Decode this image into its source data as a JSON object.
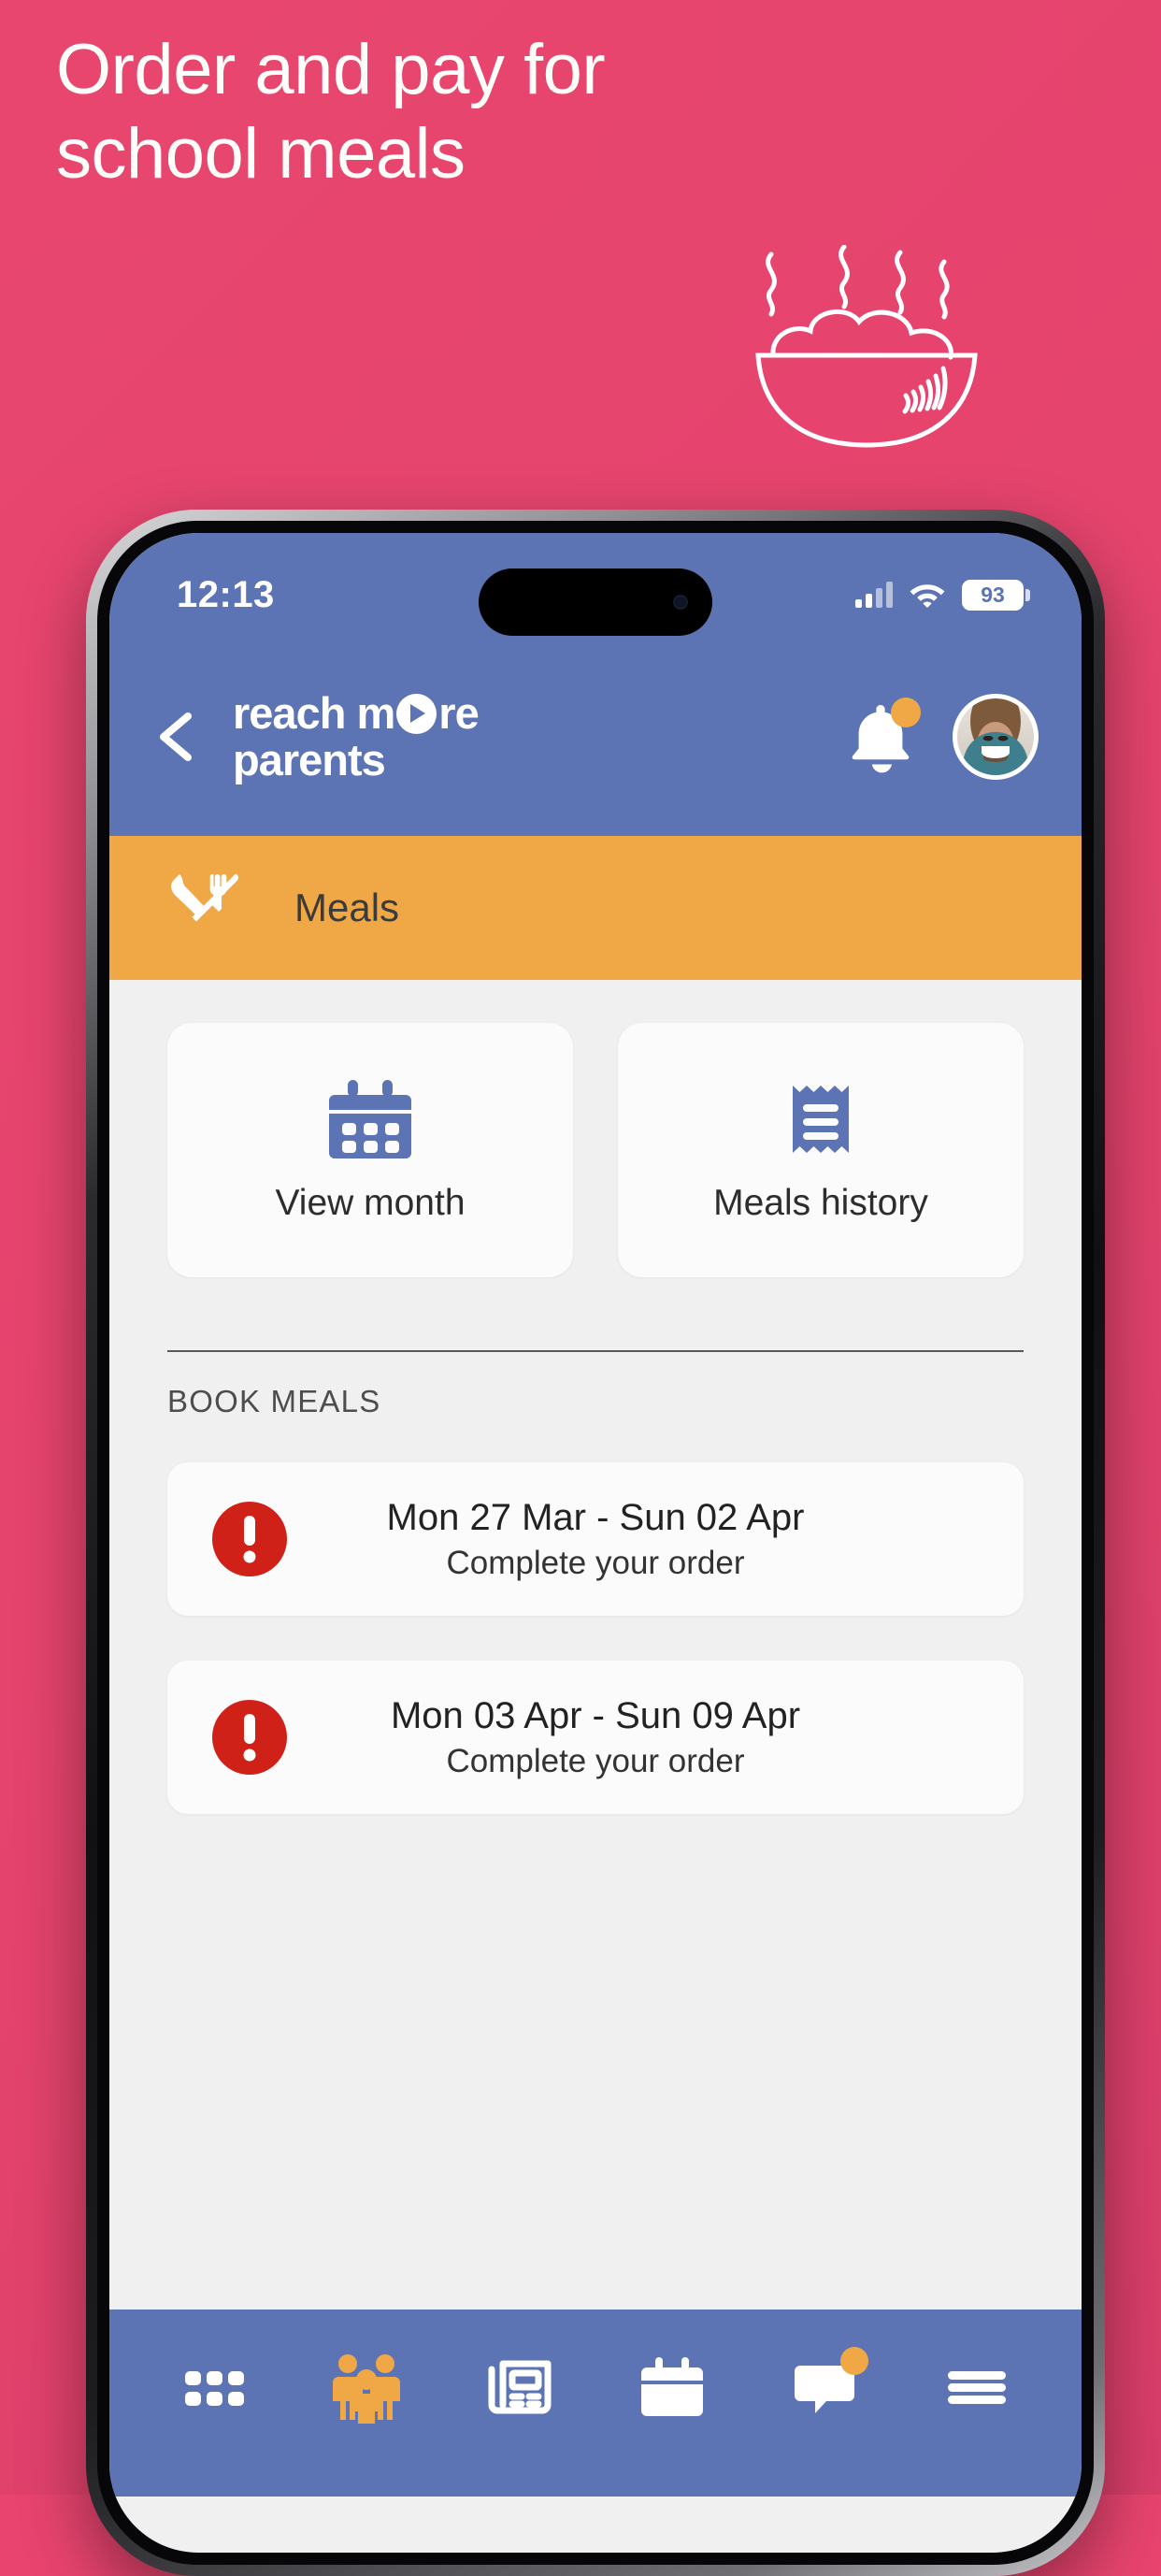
{
  "promo": {
    "headline": "Order and pay for\nschool meals",
    "background_color": "#e8446f",
    "text_color": "#fdfdfa",
    "doodle": "steaming-food-bowl-doodle"
  },
  "phone": {
    "status_bar": {
      "time": "12:13",
      "signal_icon": "cellular-signal-icon",
      "signal_bars_filled": 2,
      "signal_bars_total": 4,
      "wifi_icon": "wifi-icon",
      "battery_level": "93",
      "battery_icon": "battery-icon"
    },
    "colors": {
      "brand_blue": "#5c74b4",
      "brand_orange": "#f0a847",
      "alert_red": "#cf2118",
      "screen_background": "#f0f0f0",
      "card_background": "#fbfbfb"
    }
  },
  "header": {
    "back_icon": "chevron-left-icon",
    "logo_line1_a": "reach m",
    "logo_line1_b": "re",
    "logo_line2": "parents",
    "bell_icon": "bell-icon",
    "bell_has_badge": true,
    "avatar_icon": "user-avatar-photo"
  },
  "page_banner": {
    "icon": "fork-knife-icon",
    "title": "Meals"
  },
  "tiles": [
    {
      "icon": "calendar-icon",
      "label": "View month"
    },
    {
      "icon": "receipt-icon",
      "label": "Meals history"
    }
  ],
  "book_meals": {
    "section_label": "BOOK MEALS",
    "rows": [
      {
        "icon": "alert-exclamation-icon",
        "date_range": "Mon 27 Mar - Sun 02 Apr",
        "status": "Complete your order"
      },
      {
        "icon": "alert-exclamation-icon",
        "date_range": "Mon 03 Apr - Sun 09 Apr",
        "status": "Complete your order"
      }
    ]
  },
  "tabbar": {
    "items": [
      {
        "icon": "grid-apps-icon",
        "name": "apps",
        "active": false,
        "badge": false
      },
      {
        "icon": "family-icon",
        "name": "family",
        "active": true,
        "badge": false
      },
      {
        "icon": "newspaper-icon",
        "name": "news",
        "active": false,
        "badge": false
      },
      {
        "icon": "calendar-icon",
        "name": "calendar",
        "active": false,
        "badge": false
      },
      {
        "icon": "chat-bubble-icon",
        "name": "messages",
        "active": false,
        "badge": true
      },
      {
        "icon": "hamburger-menu-icon",
        "name": "menu",
        "active": false,
        "badge": false
      }
    ]
  }
}
